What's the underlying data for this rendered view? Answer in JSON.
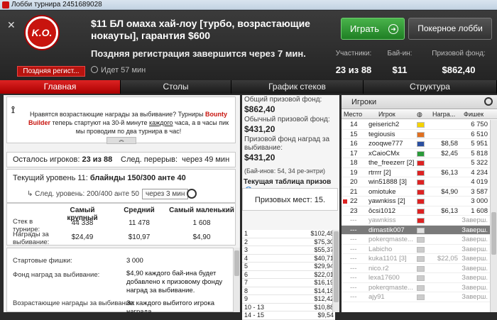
{
  "window": {
    "title": "Лобби турнира 2451689028"
  },
  "header": {
    "logo_text": "K.O.",
    "late_reg_button": "Поздняя регист...",
    "tournament_title": "$11 БЛ омаха хай-лоу [турбо, возрастающие нокауты], гарантия $600",
    "late_reg_text": "Поздняя регистрация завершится через 7 мин.",
    "elapsed": "Идет 57 мин",
    "play_button": "Играть",
    "poker_lobby_button": "Покерное лобби",
    "stats": [
      {
        "label": "Участники:",
        "value": "23 из 88"
      },
      {
        "label": "Бай-ин:",
        "value": "$11"
      },
      {
        "label": "Призовой фонд:",
        "value": "$862,40"
      }
    ]
  },
  "tabs": [
    "Главная",
    "Столы",
    "График стеков",
    "Структура"
  ],
  "main": {
    "announcement": {
      "p1": "Нравятся возрастающие награды за выбивание? Турниры ",
      "brand": "Bounty Builder",
      "p2": " теперь стартуют на 30-й минуте ",
      "underlined": "каждого",
      "p3": " часа, а в часы пик мы проводим по два турнира в час!"
    },
    "remaining_label": "Осталось игроков:",
    "remaining_value": "23 из 88",
    "next_break_label": "След. перерыв:",
    "next_break_value": "через 49 мин",
    "current_level_label": "Текущий уровень 11:",
    "current_level_value": "блайнды 150/300 анте 40",
    "next_level_label": "След. уровень:",
    "next_level_value": "200/400 анте 50",
    "next_level_time": "через 3 мин",
    "stack_headers": [
      "Самый крупный",
      "Средний",
      "Самый маленький"
    ],
    "stack_row_label": "Стек в турнире:",
    "stack_values": [
      "44 338",
      "11 478",
      "1 608"
    ],
    "bounty_row_label": "Награды за выбивание:",
    "bounty_values": [
      "$24,49",
      "$10,97",
      "$4,90"
    ],
    "start_chips_label": "Стартовые фишки:",
    "start_chips_value": "3 000",
    "bounty_fund_label": "Фонд наград за выбивание:",
    "bounty_fund_value": "$4,90 каждого бай-ина будет добавлено к призовому фонду наград за выбивание.",
    "progressive_label": "Возрастающие награды за выбивание:",
    "progressive_value": "За каждого выбитого игрока награда"
  },
  "middle": {
    "total_prize_label": "Общий призовой фонд:",
    "total_prize_value": "$862,40",
    "main_prize_label": "Обычный призовой фонд:",
    "main_prize_value": "$431,20",
    "bounty_prize_label": "Призовой фонд наград за выбивание:",
    "bounty_prize_value": "$431,20",
    "buyins_note": "(Бай-инов: 54, 34 ре-энтри)",
    "payout_title": "Текущая таблица призов",
    "prize_places": "Призовых мест: 15.",
    "payouts": [
      {
        "place": "1",
        "amount": "$102,48"
      },
      {
        "place": "2",
        "amount": "$75,30"
      },
      {
        "place": "3",
        "amount": "$55,37"
      },
      {
        "place": "4",
        "amount": "$40,71"
      },
      {
        "place": "5",
        "amount": "$29,94"
      },
      {
        "place": "6",
        "amount": "$22,01"
      },
      {
        "place": "7",
        "amount": "$16,19"
      },
      {
        "place": "8",
        "amount": "$14,18"
      },
      {
        "place": "9",
        "amount": "$12,42"
      },
      {
        "place": "10 - 13",
        "amount": "$10,88"
      },
      {
        "place": "14 - 15",
        "amount": "$9,54"
      }
    ]
  },
  "players": {
    "title": "Игроки",
    "columns": [
      "Место",
      "Игрок",
      "Награ...",
      "Фишек"
    ],
    "rows": [
      {
        "place": "14",
        "name": "geiserich2",
        "flag": "#f5d300",
        "bounty": "",
        "chips": "6 750",
        "state": "normal"
      },
      {
        "place": "15",
        "name": "tegiousis",
        "flag": "#e07020",
        "bounty": "",
        "chips": "6 510",
        "state": "normal"
      },
      {
        "place": "16",
        "name": "zooqwe777",
        "flag": "#2a4fa0",
        "bounty": "$8,58",
        "chips": "5 951",
        "state": "normal"
      },
      {
        "place": "17",
        "name": "xCaioCMx",
        "flag": "#2a9a3a",
        "bounty": "$2,45",
        "chips": "5 818",
        "state": "normal"
      },
      {
        "place": "18",
        "name": "the_freezerr [2]",
        "flag": "#d22",
        "bounty": "",
        "chips": "5 322",
        "state": "normal"
      },
      {
        "place": "19",
        "name": "rtrrrr [2]",
        "flag": "#d22",
        "bounty": "$6,13",
        "chips": "4 234",
        "state": "normal"
      },
      {
        "place": "20",
        "name": "win51888 [3]",
        "flag": "#d22",
        "bounty": "",
        "chips": "4 019",
        "state": "normal"
      },
      {
        "place": "21",
        "name": "omiotuke",
        "flag": "#d22",
        "bounty": "$4,90",
        "chips": "3 587",
        "state": "normal"
      },
      {
        "place": "22",
        "name": "yawnkiss [2]",
        "flag": "#d22",
        "bounty": "",
        "chips": "3 000",
        "state": "marked"
      },
      {
        "place": "23",
        "name": "ōcsi1012",
        "flag": "#d22",
        "bounty": "$6,13",
        "chips": "1 608",
        "state": "normal"
      },
      {
        "place": "---",
        "name": "yawnkiss",
        "flag": "#d22",
        "bounty": "",
        "chips": "Заверш.",
        "state": "out"
      },
      {
        "place": "---",
        "name": "dimastik007",
        "flag": "#ddd",
        "bounty": "",
        "chips": "Заверш.",
        "state": "selected"
      },
      {
        "place": "---",
        "name": "pokerqmaste...",
        "flag": "#ccc",
        "bounty": "",
        "chips": "Заверш.",
        "state": "out"
      },
      {
        "place": "---",
        "name": "Labicho",
        "flag": "#ccc",
        "bounty": "",
        "chips": "Заверш.",
        "state": "out"
      },
      {
        "place": "---",
        "name": "kuka1101 [3]",
        "flag": "#ccc",
        "bounty": "$22,05",
        "chips": "Заверш.",
        "state": "out"
      },
      {
        "place": "---",
        "name": "nico.r2",
        "flag": "#ccc",
        "bounty": "",
        "chips": "Заверш.",
        "state": "out"
      },
      {
        "place": "---",
        "name": "lexa17600",
        "flag": "#ccc",
        "bounty": "",
        "chips": "Заверш.",
        "state": "out"
      },
      {
        "place": "---",
        "name": "pokerqmaste...",
        "flag": "#ccc",
        "bounty": "",
        "chips": "Заверш.",
        "state": "out"
      },
      {
        "place": "---",
        "name": "ajy91",
        "flag": "#ccc",
        "bounty": "",
        "chips": "Заверш.",
        "state": "out"
      }
    ]
  }
}
